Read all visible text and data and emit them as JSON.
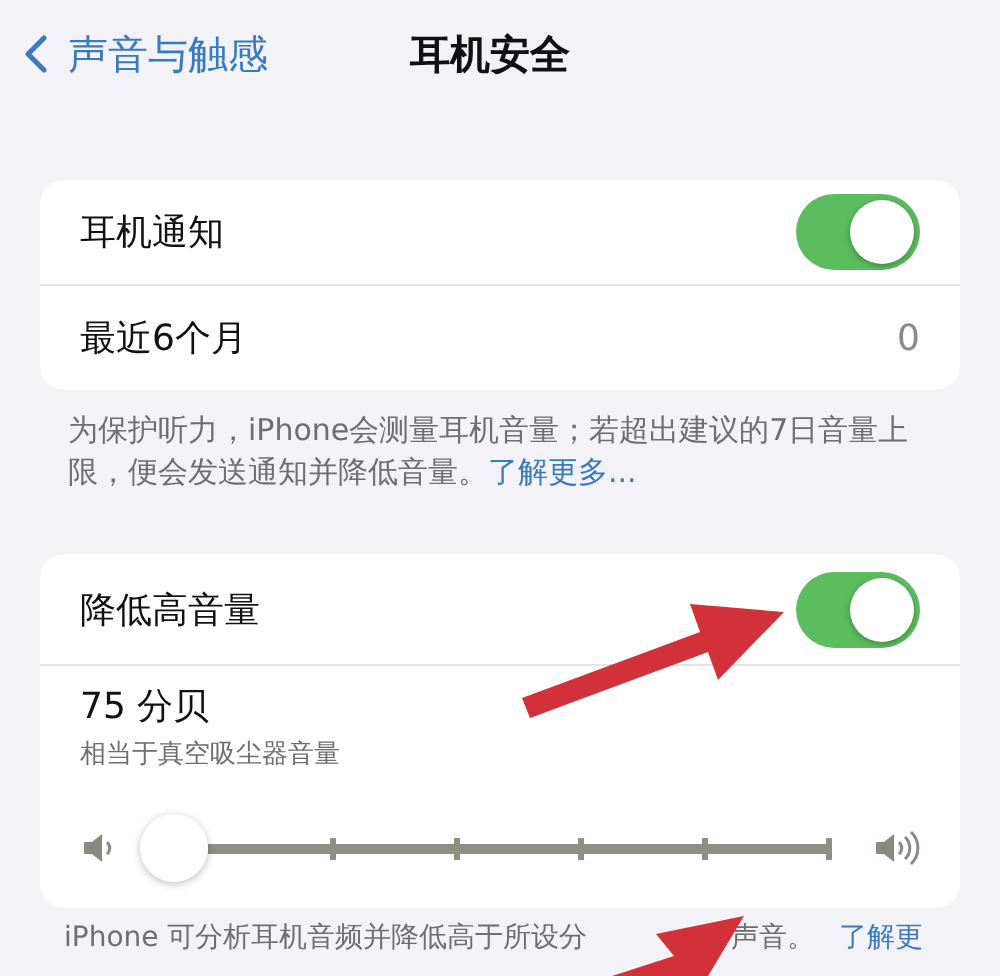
{
  "nav": {
    "back": "声音与触感",
    "title": "耳机安全"
  },
  "notify_group": {
    "rows": [
      {
        "kind": "toggle",
        "label": "耳机通知",
        "on": true
      },
      {
        "kind": "value",
        "label": "最近6个月",
        "value": "0"
      }
    ]
  },
  "notify_footer": {
    "text": "为保护听力，iPhone会测量耳机音量；若超出建议的7日音量上限，便会发送通知并降低音量。",
    "link": "了解更多..."
  },
  "reduce_group": {
    "label": "降低高音量",
    "on": true,
    "level_title": "75 分贝",
    "level_subtitle": "相当于真空吸尘器音量",
    "slider": {
      "level": 0
    }
  },
  "reduce_footer": {
    "text_parts": [
      "iPhone 可分析耳机音频并降低高于所设分",
      "声音。"
    ],
    "link": "了解更"
  }
}
